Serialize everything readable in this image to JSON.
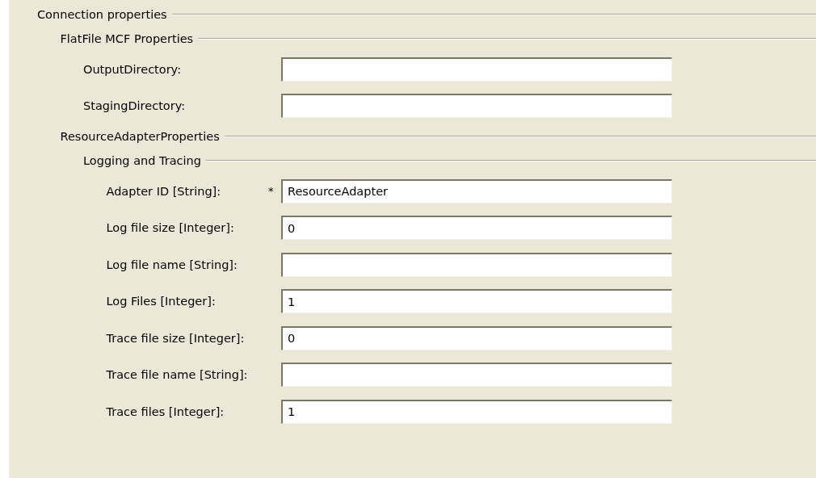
{
  "sections": [
    {
      "title": "Connection properties",
      "children": [
        {
          "title": "FlatFile MCF Properties",
          "fields": [
            {
              "label": "OutputDirectory:"
            },
            {
              "label": "StagingDirectory:"
            }
          ]
        },
        {
          "title": "ResourceAdapterProperties",
          "children": [
            {
              "title": "Logging and Tracing",
              "fields": [
                {
                  "label": "Adapter ID [String]:",
                  "required_mark": "*",
                  "value": "ResourceAdapter"
                },
                {
                  "label": "Log file size [Integer]:",
                  "value": "0"
                },
                {
                  "label": "Log file name [String]:"
                },
                {
                  "label": "Log Files [Integer]:",
                  "value": "1"
                },
                {
                  "label": "Trace file size [Integer]:",
                  "value": "0"
                },
                {
                  "label": "Trace file name [String]:"
                },
                {
                  "label": "Trace files [Integer]:",
                  "value": "1"
                }
              ]
            }
          ]
        }
      ]
    }
  ]
}
